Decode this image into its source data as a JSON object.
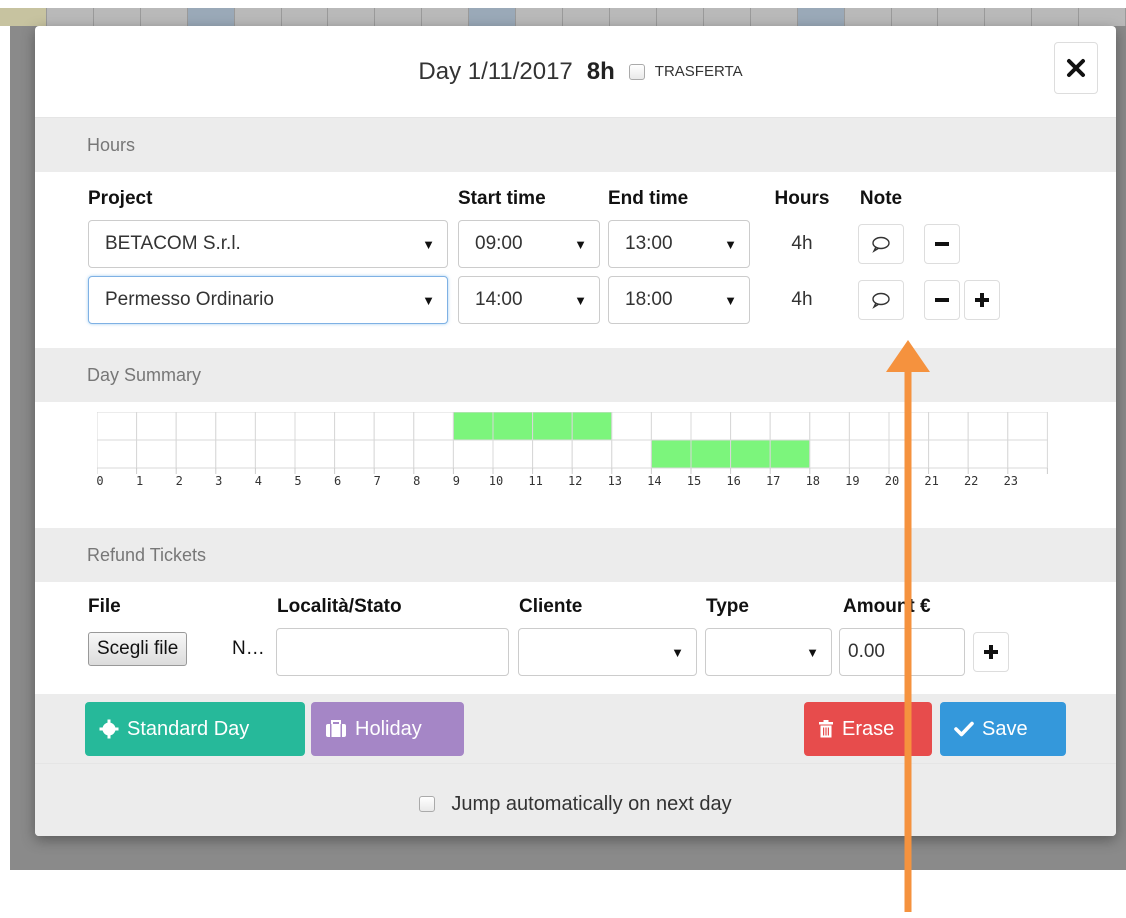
{
  "header": {
    "day_title": "Day 1/11/2017",
    "day_hours": "8h",
    "trasferta_label": "TRASFERTA",
    "close_icon": "times-icon"
  },
  "hours_section": {
    "title": "Hours",
    "columns": {
      "project": "Project",
      "start_time": "Start time",
      "end_time": "End time",
      "hours": "Hours",
      "note": "Note"
    },
    "rows": [
      {
        "project": "BETACOM S.r.l.",
        "start": "09:00",
        "end": "13:00",
        "hours": "4h"
      },
      {
        "project": "Permesso Ordinario",
        "start": "14:00",
        "end": "18:00",
        "hours": "4h"
      }
    ]
  },
  "day_summary": {
    "title": "Day Summary",
    "hour_labels": [
      "0",
      "1",
      "2",
      "3",
      "4",
      "5",
      "6",
      "7",
      "8",
      "9",
      "10",
      "11",
      "12",
      "13",
      "14",
      "15",
      "16",
      "17",
      "18",
      "19",
      "20",
      "21",
      "22",
      "23"
    ],
    "filled_color": "#7cf57c",
    "row1_fill_hours": [
      9,
      10,
      11,
      12
    ],
    "row2_fill_hours": [
      14,
      15,
      16,
      17
    ]
  },
  "refund_section": {
    "title": "Refund Tickets",
    "columns": {
      "file": "File",
      "localita": "Località/Stato",
      "cliente": "Cliente",
      "type": "Type",
      "amount": "Amount €"
    },
    "file_button": "Scegli file",
    "file_none": "N…",
    "amount_value": "0.00"
  },
  "buttons": {
    "standard_day": "Standard Day",
    "holiday": "Holiday",
    "erase": "Erase",
    "save": "Save"
  },
  "footer": {
    "jump_label": "Jump automatically on next day"
  },
  "colors": {
    "standard": "#26b99a",
    "holiday": "#a586c6",
    "erase": "#e74c4c",
    "save": "#3498db",
    "annotation_arrow": "#f5923e"
  }
}
